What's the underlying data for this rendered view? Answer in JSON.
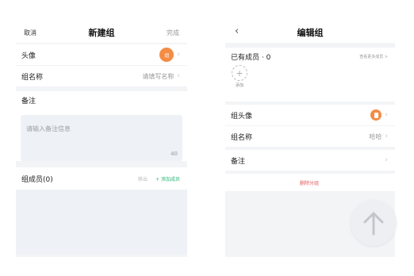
{
  "new_group": {
    "cancel_label": "取消",
    "title": "新建组",
    "done_label": "完成",
    "avatar_label": "头像",
    "avatar_badge": "组",
    "name_label": "组名称",
    "name_placeholder": "请填写名称",
    "memo_label": "备注",
    "memo_placeholder": "请输入备注信息",
    "memo_count": "40",
    "members_label": "组成员(0)",
    "remove_label": "移出",
    "add_member_label": "+ 添加成员"
  },
  "edit_group": {
    "title": "编辑组",
    "back_icon": "chevron-left-icon",
    "members_label": "已有成员 · 0",
    "view_more_label": "查看更多成员 >",
    "add_label": "添加",
    "avatar_label": "组头像",
    "name_label": "组名称",
    "name_value": "哈哈",
    "memo_label": "备注",
    "delete_label": "删除分组"
  },
  "colors": {
    "accent_orange": "#f48c45",
    "accent_green": "#2cb87a",
    "danger_red": "#e45a5a",
    "background": "#f3f4f6"
  },
  "icons": {
    "scroll_top": "arrow-up-icon",
    "chevron": "chevron-right-icon",
    "add": "plus-icon"
  }
}
